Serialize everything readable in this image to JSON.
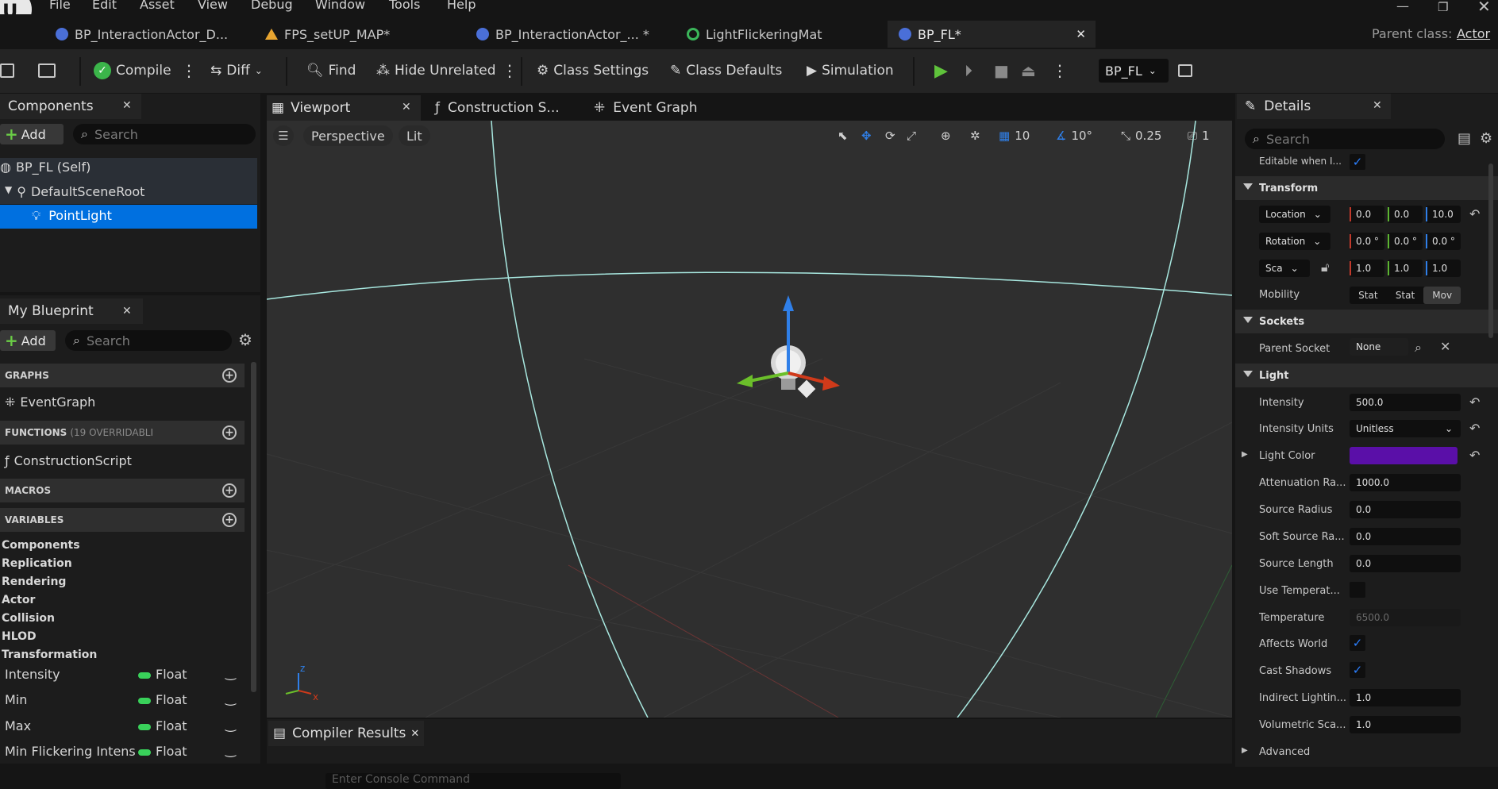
{
  "menu": [
    "File",
    "Edit",
    "Asset",
    "View",
    "Debug",
    "Window",
    "Tools",
    "Help"
  ],
  "tabs": [
    {
      "label": "BP_InteractionActor_D..."
    },
    {
      "label": "FPS_setUP_MAP*"
    },
    {
      "label": "BP_InteractionActor_... *"
    },
    {
      "label": "LightFlickeringMat"
    },
    {
      "label": "BP_FL*"
    }
  ],
  "parent_class": {
    "label": "Parent class:",
    "value": "Actor"
  },
  "toolbar": {
    "compile": "Compile",
    "diff": "Diff",
    "find": "Find",
    "hide_unrelated": "Hide Unrelated",
    "class_settings": "Class Settings",
    "class_defaults": "Class Defaults",
    "simulation": "Simulation",
    "debug_object": "BP_FL"
  },
  "components": {
    "title": "Components",
    "add": "Add",
    "search_placeholder": "Search",
    "tree": [
      "BP_FL (Self)",
      "DefaultSceneRoot",
      "PointLight"
    ]
  },
  "my_blueprint": {
    "title": "My Blueprint",
    "add": "Add",
    "search_placeholder": "Search",
    "graphs_header": "GRAPHS",
    "graph_item": "EventGraph",
    "functions_header": "FUNCTIONS",
    "functions_note": "(19 OVERRIDABLI",
    "function_item": "ConstructionScript",
    "macros_header": "MACROS",
    "variables_header": "VARIABLES",
    "categories": [
      "Components",
      "Replication",
      "Rendering",
      "Actor",
      "Collision",
      "HLOD",
      "Transformation"
    ],
    "variables": [
      {
        "name": "Intensity",
        "type": "Float"
      },
      {
        "name": "Min",
        "type": "Float"
      },
      {
        "name": "Max",
        "type": "Float"
      },
      {
        "name": "Min Flickering Intens",
        "type": "Float"
      }
    ]
  },
  "editor_tabs": {
    "viewport": "Viewport",
    "construction": "Construction S...",
    "event_graph": "Event Graph"
  },
  "viewport": {
    "perspective": "Perspective",
    "lit": "Lit",
    "grid": "10",
    "angle": "10°",
    "scale": "0.25",
    "camera": "1"
  },
  "bottom": {
    "compiler_results": "Compiler Results",
    "console_placeholder": "Enter Console Command"
  },
  "details": {
    "title": "Details",
    "search_placeholder": "Search",
    "editable_label": "Editable when I...",
    "transform_header": "Transform",
    "location": {
      "label": "Location",
      "x": "0.0",
      "y": "0.0",
      "z": "10.0"
    },
    "rotation": {
      "label": "Rotation",
      "x": "0.0 °",
      "y": "0.0 °",
      "z": "0.0 °"
    },
    "scale": {
      "label": "Sca",
      "x": "1.0",
      "y": "1.0",
      "z": "1.0"
    },
    "mobility": {
      "label": "Mobility",
      "options": [
        "Stat",
        "Stat",
        "Mov"
      ]
    },
    "sockets_header": "Sockets",
    "parent_socket": {
      "label": "Parent Socket",
      "value": "None"
    },
    "light_header": "Light",
    "rows": [
      {
        "label": "Intensity",
        "value": "500.0"
      },
      {
        "label": "Intensity Units",
        "value": "Unitless"
      },
      {
        "label": "Light Color",
        "value": ""
      },
      {
        "label": "Attenuation Ra...",
        "value": "1000.0"
      },
      {
        "label": "Source Radius",
        "value": "0.0"
      },
      {
        "label": "Soft Source Ra...",
        "value": "0.0"
      },
      {
        "label": "Source Length",
        "value": "0.0"
      },
      {
        "label": "Use Temperat...",
        "value": ""
      },
      {
        "label": "Temperature",
        "value": "6500.0"
      },
      {
        "label": "Affects World",
        "value": ""
      },
      {
        "label": "Cast Shadows",
        "value": ""
      },
      {
        "label": "Indirect Lightin...",
        "value": "1.0"
      },
      {
        "label": "Volumetric Sca...",
        "value": "1.0"
      }
    ],
    "advanced": "Advanced",
    "light_color_hex": "#5a0fa8"
  },
  "colors": {
    "accent": "#0070e0",
    "play": "#5fc33b"
  }
}
